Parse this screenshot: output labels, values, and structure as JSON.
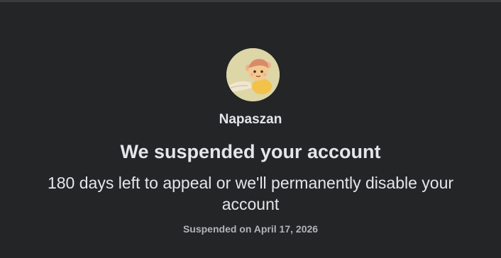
{
  "profile": {
    "name": "Napaszan",
    "avatar_icon": "cartoon-monkey-avatar"
  },
  "notice": {
    "title": "We suspended your account",
    "message": "180 days left to appeal or we'll permanently disable your account",
    "suspended_date": "Suspended on April 17, 2026"
  },
  "colors": {
    "background": "#242526",
    "text_primary": "#e4e6eb",
    "text_secondary": "#b0b3b8"
  }
}
